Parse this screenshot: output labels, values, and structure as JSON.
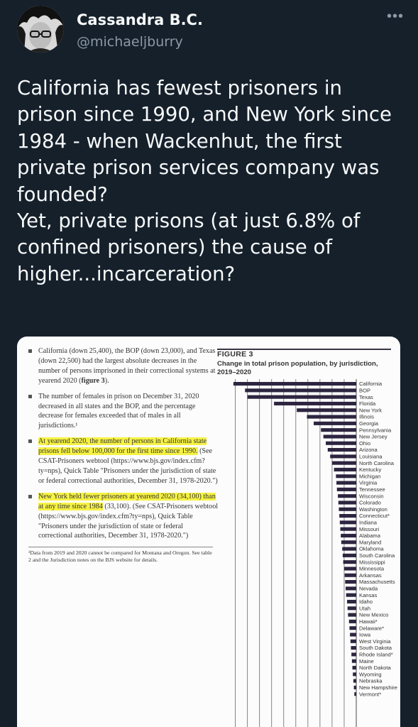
{
  "user": {
    "name": "Cassandra B.C.",
    "handle": "@michaeljburry",
    "more_label": "•••"
  },
  "tweet": {
    "paragraphs": [
      "California has fewest prisoners in prison since 1990, and New York since 1984 - when Wackenhut, the first private prison services company was founded?",
      "Yet, private prisons (at just 6.8% of confined prisoners) the cause of higher...incarceration?"
    ]
  },
  "image": {
    "bullets": [
      {
        "segments": [
          {
            "text": "California (down 25,400), the BOP (down 23,000), and Texas (down 22,500) had the largest absolute decreases in the number of persons imprisoned in their correctional systems at yearend 2020 (",
            "hl": false
          },
          {
            "text": "figure 3",
            "hl": false,
            "bold": true
          },
          {
            "text": ").",
            "hl": false
          }
        ]
      },
      {
        "segments": [
          {
            "text": "The number of females in prison on December 31, 2020 decreased in all states and the BOP, and the percentage decrease for females exceeded that of males in all jurisdictions.¹",
            "hl": false
          }
        ]
      },
      {
        "segments": [
          {
            "text": "At yearend 2020, the number of persons in California state prisons fell below 100,000 for the first time since 1990.",
            "hl": true
          },
          {
            "text": " (See CSAT-Prisoners webtool (https://www.bjs.gov/index.cfm?ty=nps), Quick Table \"Prisoners under the jurisdiction of state or federal correctional authorities, December 31, 1978-2020.\")",
            "hl": false
          }
        ]
      },
      {
        "segments": [
          {
            "text": "New York held fewer prisoners at yearend 2020 (34,100) than at any time since 1984",
            "hl": true
          },
          {
            "text": " (33,100). (See CSAT-Prisoners webtool (https://www.bjs.gov/index.cfm?ty=nps), Quick Table \"Prisoners under the jurisdiction of state or federal correctional authorities, December 31, 1978-2020.\")",
            "hl": false
          }
        ]
      }
    ],
    "footnote": "¹Data from 2019 and 2020 cannot be compared for Montana and Oregon. See table 2 and the Jurisdiction notes on the BJS website for details.",
    "figure_title": "FIGURE 3",
    "figure_caption": "Change in total prison population, by jurisdiction, 2019–2020"
  },
  "chart_data": {
    "type": "bar",
    "orientation": "horizontal",
    "title": "Change in total prison population, by jurisdiction, 2019–2020",
    "categories": [
      "California",
      "BOP",
      "Texas",
      "Florida",
      "New York",
      "Illinois",
      "Georgia",
      "Pennsylvania",
      "New Jersey",
      "Ohio",
      "Arizona",
      "Louisiana",
      "North Carolina",
      "Kentucky",
      "Michigan",
      "Virginia",
      "Tennessee",
      "Wisconsin",
      "Colorado",
      "Washington",
      "Connecticut*",
      "Indiana",
      "Missouri",
      "Alabama",
      "Maryland",
      "Oklahoma",
      "South Carolina",
      "Mississippi",
      "Minnesota",
      "Arkansas",
      "Massachusetts",
      "Nevada",
      "Kansas",
      "Idaho",
      "Utah",
      "New Mexico",
      "Hawaii*",
      "Delaware*",
      "Iowa",
      "West Virginia",
      "South Dakota",
      "Rhode Island*",
      "Maine",
      "North Dakota",
      "Wyoming",
      "Nebraska",
      "New Hampshire",
      "Vermont*"
    ],
    "values": [
      -25400,
      -23000,
      -22500,
      -17000,
      -12300,
      -10200,
      -8800,
      -7300,
      -6800,
      -6300,
      -5900,
      -5400,
      -5000,
      -4600,
      -4200,
      -4100,
      -4000,
      -3800,
      -3700,
      -3600,
      -3500,
      -3400,
      -3300,
      -3200,
      -3100,
      -2900,
      -2800,
      -2700,
      -2500,
      -2400,
      -2300,
      -2200,
      -2100,
      -1900,
      -1800,
      -1700,
      -1500,
      -1400,
      -1300,
      -1200,
      -1100,
      -1000,
      -900,
      -800,
      -700,
      -600,
      -500,
      -400
    ],
    "xlim": [
      -27000,
      0
    ],
    "colors": {
      "bar": "#2d2540",
      "grid": "#666666"
    }
  }
}
